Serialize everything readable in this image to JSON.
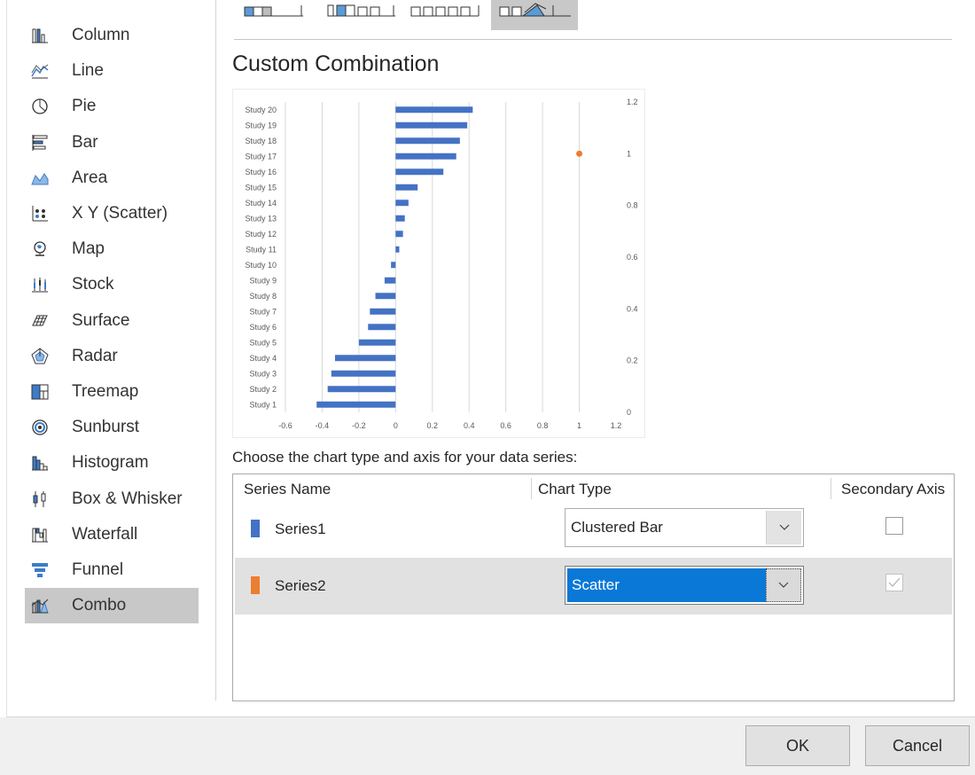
{
  "chart_types": [
    {
      "label": "Column",
      "icon": "column-chart-icon"
    },
    {
      "label": "Line",
      "icon": "line-chart-icon"
    },
    {
      "label": "Pie",
      "icon": "pie-chart-icon"
    },
    {
      "label": "Bar",
      "icon": "bar-chart-icon"
    },
    {
      "label": "Area",
      "icon": "area-chart-icon"
    },
    {
      "label": "X Y (Scatter)",
      "icon": "scatter-chart-icon"
    },
    {
      "label": "Map",
      "icon": "map-chart-icon"
    },
    {
      "label": "Stock",
      "icon": "stock-chart-icon"
    },
    {
      "label": "Surface",
      "icon": "surface-chart-icon"
    },
    {
      "label": "Radar",
      "icon": "radar-chart-icon"
    },
    {
      "label": "Treemap",
      "icon": "treemap-chart-icon"
    },
    {
      "label": "Sunburst",
      "icon": "sunburst-chart-icon"
    },
    {
      "label": "Histogram",
      "icon": "histogram-chart-icon"
    },
    {
      "label": "Box & Whisker",
      "icon": "box-whisker-chart-icon"
    },
    {
      "label": "Waterfall",
      "icon": "waterfall-chart-icon"
    },
    {
      "label": "Funnel",
      "icon": "funnel-chart-icon"
    },
    {
      "label": "Combo",
      "icon": "combo-chart-icon",
      "selected": true
    }
  ],
  "section_title": "Custom Combination",
  "series_prompt": "Choose the chart type and axis for your data series:",
  "series_table": {
    "headers": {
      "name": "Series Name",
      "type": "Chart Type",
      "secondary": "Secondary Axis"
    },
    "rows": [
      {
        "name": "Series1",
        "color": "#4472c4",
        "chart_type": "Clustered Bar",
        "secondary_axis": false
      },
      {
        "name": "Series2",
        "color": "#ed7d31",
        "chart_type": "Scatter",
        "secondary_axis": true
      }
    ]
  },
  "buttons": {
    "ok": "OK",
    "cancel": "Cancel"
  },
  "colors": {
    "accent": "#0a78d7",
    "series1": "#4472c4",
    "series2": "#ed7d31",
    "selected_bg": "#c8c8c8"
  },
  "chart_data": {
    "type": "bar",
    "categories": [
      "Study 1",
      "Study 2",
      "Study 3",
      "Study 4",
      "Study 5",
      "Study 6",
      "Study 7",
      "Study 8",
      "Study 9",
      "Study 10",
      "Study 11",
      "Study 12",
      "Study 13",
      "Study 14",
      "Study 15",
      "Study 16",
      "Study 17",
      "Study 18",
      "Study 19",
      "Study 20"
    ],
    "series": [
      {
        "values": [
          -0.43,
          -0.37,
          -0.35,
          -0.33,
          -0.2,
          -0.15,
          -0.14,
          -0.11,
          -0.06,
          -0.025,
          0.02,
          0.04,
          0.05,
          0.07,
          0.12,
          0.26,
          0.33,
          0.35,
          0.39,
          0.42
        ]
      },
      {
        "type": "scatter",
        "points": [
          [
            1,
            1
          ]
        ]
      }
    ],
    "x_ticks": [
      "-0.6",
      "-0.4",
      "-0.2",
      "0",
      "0.2",
      "0.4",
      "0.6",
      "0.8",
      "1",
      "1.2"
    ],
    "xlim": [
      -0.6,
      1.2
    ],
    "secondary_y_ticks": [
      "0",
      "0.2",
      "0.4",
      "0.6",
      "0.8",
      "1",
      "1.2"
    ],
    "secondary_ylim": [
      0,
      1.2
    ],
    "grid": "vertical"
  }
}
